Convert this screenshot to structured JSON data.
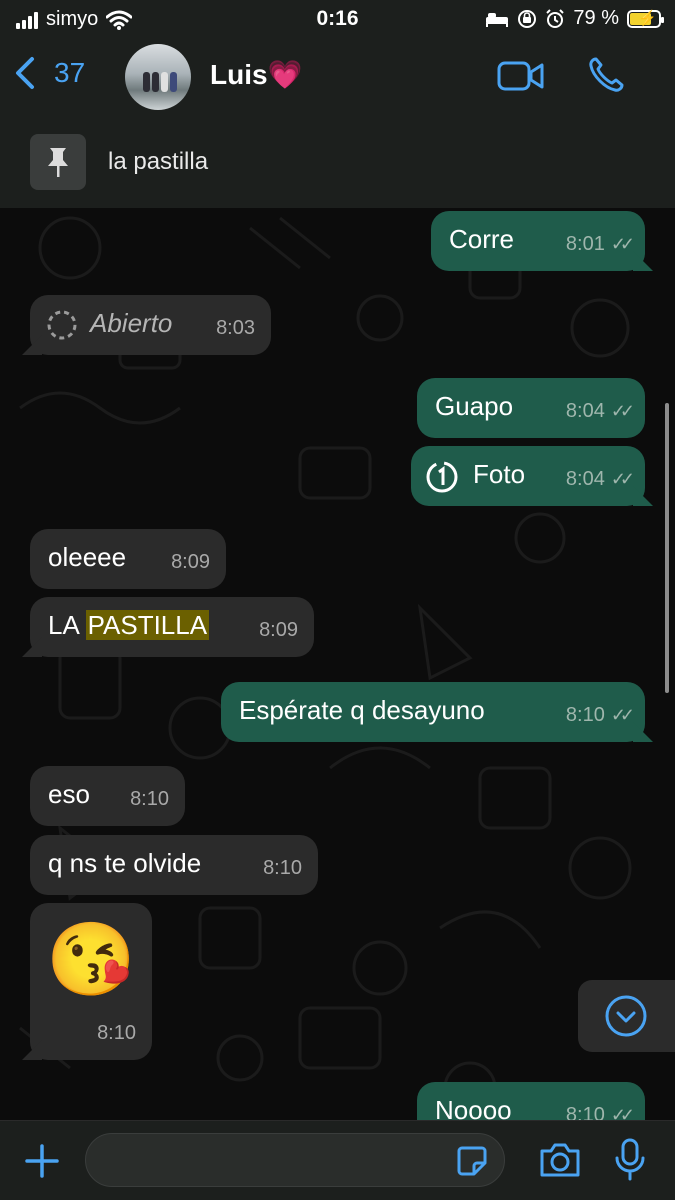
{
  "status": {
    "carrier": "simyo",
    "time": "0:16",
    "battery": "79 %"
  },
  "header": {
    "back_count": "37",
    "contact_name": "Luis",
    "contact_emoji": "💗"
  },
  "pinned": {
    "text": "la pastilla"
  },
  "messages": [
    {
      "side": "out",
      "text": "Corre",
      "time": "8:01"
    },
    {
      "side": "in",
      "text": "Abierto",
      "time": "8:03",
      "kind": "view-once-opened"
    },
    {
      "side": "out",
      "text": "Guapo",
      "time": "8:04"
    },
    {
      "side": "out",
      "text": "Foto",
      "time": "8:04",
      "kind": "view-once"
    },
    {
      "side": "in",
      "text": "oleeee",
      "time": "8:09"
    },
    {
      "side": "in",
      "text_prefix": "LA ",
      "text_highlight": "PASTILLA",
      "time": "8:09"
    },
    {
      "side": "out",
      "text": "Espérate q desayuno",
      "time": "8:10"
    },
    {
      "side": "in",
      "text": "eso",
      "time": "8:10"
    },
    {
      "side": "in",
      "text": "q ns te olvide",
      "time": "8:10"
    },
    {
      "side": "in",
      "emoji": "😘",
      "time": "8:10"
    },
    {
      "side": "out",
      "text": "Noooo",
      "time": "8:10"
    }
  ],
  "colors": {
    "accent": "#4aa3f2",
    "outgoing_bubble": "#1f5c4b",
    "incoming_bubble": "#2b2b2b",
    "highlight": "#6b6000"
  },
  "icons": {
    "pin": "pin-icon",
    "video": "video-call-icon",
    "phone": "phone-icon",
    "plus": "plus-icon",
    "sticker": "sticker-icon",
    "camera": "camera-icon",
    "mic": "mic-icon",
    "scroll_down": "chevron-down-icon"
  },
  "input": {
    "value": "",
    "placeholder": ""
  }
}
